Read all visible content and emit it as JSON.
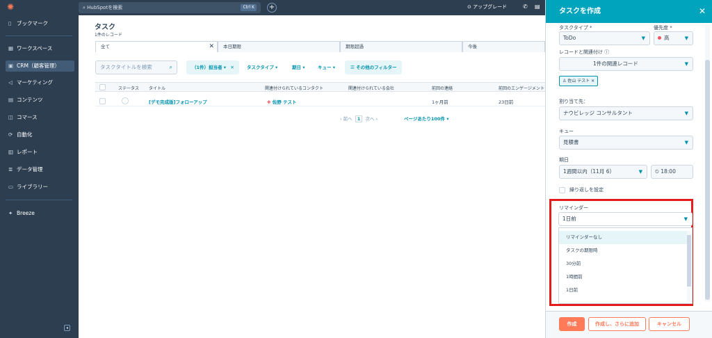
{
  "topbar": {
    "search_placeholder": "HubSpotを検索",
    "search_shortcut": "Ctrl K",
    "upgrade_label": "アップグレード"
  },
  "sidebar": {
    "bookmark": "ブックマーク",
    "items": [
      {
        "label": "ワークスペース",
        "icon": "grid-icon"
      },
      {
        "label": "CRM（顧客管理）",
        "icon": "crm-icon"
      },
      {
        "label": "マーケティング",
        "icon": "megaphone-icon"
      },
      {
        "label": "コンテンツ",
        "icon": "content-icon"
      },
      {
        "label": "コマース",
        "icon": "commerce-icon"
      },
      {
        "label": "自動化",
        "icon": "automation-icon"
      },
      {
        "label": "レポート",
        "icon": "chart-icon"
      },
      {
        "label": "データ管理",
        "icon": "database-icon"
      },
      {
        "label": "ライブラリー",
        "icon": "folder-icon"
      }
    ],
    "breeze": "Breeze"
  },
  "page": {
    "title": "タスク",
    "subtitle": "1件のレコード",
    "tabs": [
      "全て",
      "本日期限",
      "期限超過",
      "今後"
    ],
    "search_placeholder": "タスクタイトルを検索",
    "filters": {
      "owner": "（1件）担当者",
      "task_type": "タスクタイプ",
      "due": "期日",
      "queue": "キュー",
      "more": "その他のフィルター"
    },
    "columns": [
      "ステータス",
      "タイトル",
      "関連付けられているコンタクト",
      "関連付けられている会社",
      "前回の連絡",
      "前回のエンゲージメント"
    ],
    "rows": [
      {
        "title": "[デモ完成版]フォローアップ",
        "contact": "佐野 テスト",
        "company": "",
        "last_contact": "1ヶ月前",
        "last_engagement": "23日前"
      }
    ],
    "pager": {
      "prev": "前へ",
      "page": "1",
      "next": "次へ",
      "per_page": "ページあたり100件"
    }
  },
  "panel": {
    "title": "タスクを作成",
    "task_type_label": "タスクタイプ *",
    "task_type_value": "ToDo",
    "priority_label": "優先度 *",
    "priority_value": "高",
    "record_label": "レコードと関連付け",
    "record_value": "1件の関連レコード",
    "contact_chip": "佐山 テスト",
    "assign_label": "割り当て先：",
    "assign_value": "ナウビレッジ コンサルタント",
    "queue_label": "キュー",
    "queue_value": "見積書",
    "due_label": "期日",
    "due_value": "1週間以内（11月 6）",
    "due_time": "18:00",
    "repeat_label": "繰り返しを設定",
    "reminder_label": "リマインダー",
    "reminder_value": "1日前",
    "reminder_options": [
      "リマインダーなし",
      "タスクの期限時",
      "30分前",
      "1時間前",
      "1日前"
    ],
    "buttons": {
      "create": "作成",
      "create_add": "作成し、さらに追加",
      "cancel": "キャンセル"
    }
  },
  "colors": {
    "accent": "#00a4bd",
    "nav_bg": "#2d3e50",
    "primary_button": "#ff7a59",
    "highlight": "#e41c1c"
  }
}
